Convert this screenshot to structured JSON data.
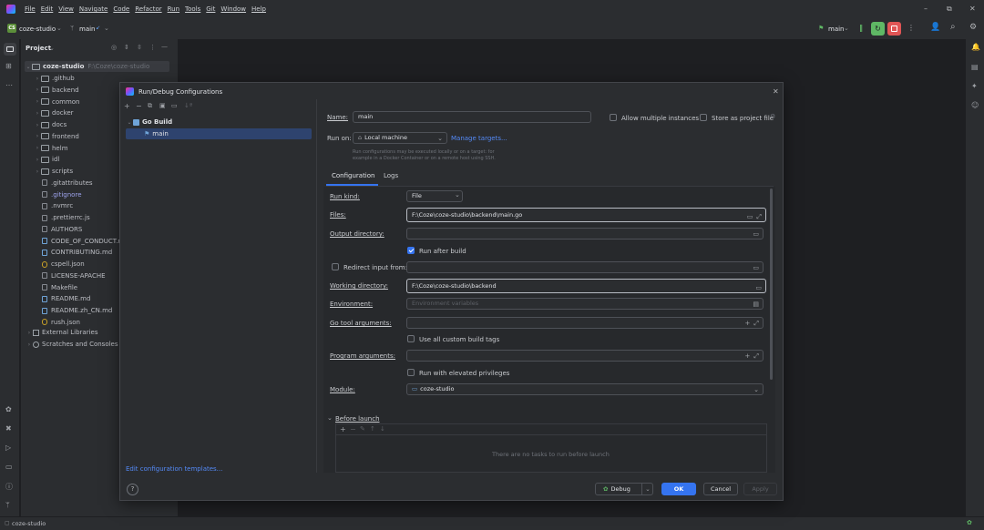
{
  "menu": [
    "File",
    "Edit",
    "View",
    "Navigate",
    "Code",
    "Refactor",
    "Run",
    "Tools",
    "Git",
    "Window",
    "Help"
  ],
  "toolbar": {
    "project_badge": "CS",
    "project_name": "coze-studio",
    "branch": "main",
    "run_config": "main"
  },
  "project_pane": {
    "title": "Project",
    "root_name": "coze-studio",
    "root_path": "F:\\Coze\\coze-studio",
    "items": [
      {
        "label": ".github",
        "type": "folder"
      },
      {
        "label": "backend",
        "type": "folder"
      },
      {
        "label": "common",
        "type": "folder"
      },
      {
        "label": "docker",
        "type": "folder"
      },
      {
        "label": "docs",
        "type": "folder"
      },
      {
        "label": "frontend",
        "type": "folder"
      },
      {
        "label": "helm",
        "type": "folder"
      },
      {
        "label": "idl",
        "type": "folder"
      },
      {
        "label": "scripts",
        "type": "folder"
      },
      {
        "label": ".gitattributes",
        "type": "file"
      },
      {
        "label": ".gitignore",
        "type": "file"
      },
      {
        "label": ".nvmrc",
        "type": "file"
      },
      {
        "label": ".prettierrc.js",
        "type": "file"
      },
      {
        "label": "AUTHORS",
        "type": "file"
      },
      {
        "label": "CODE_OF_CONDUCT.md",
        "type": "md"
      },
      {
        "label": "CONTRIBUTING.md",
        "type": "md"
      },
      {
        "label": "cspell.json",
        "type": "json"
      },
      {
        "label": "LICENSE-APACHE",
        "type": "file"
      },
      {
        "label": "Makefile",
        "type": "file"
      },
      {
        "label": "README.md",
        "type": "md"
      },
      {
        "label": "README.zh_CN.md",
        "type": "md"
      },
      {
        "label": "rush.json",
        "type": "json"
      }
    ],
    "external_libraries": "External Libraries",
    "scratches": "Scratches and Consoles"
  },
  "dialog": {
    "title": "Run/Debug Configurations",
    "tree_group": "Go Build",
    "tree_item": "main",
    "edit_templates": "Edit configuration templates...",
    "name_label": "Name:",
    "name_value": "main",
    "allow_multiple": "Allow multiple instances",
    "store_as_project_file": "Store as project file",
    "run_on_label": "Run on:",
    "run_on_value": "Local machine",
    "manage_targets": "Manage targets...",
    "run_on_hint_1": "Run configurations may be executed locally or on a target: for",
    "run_on_hint_2": "example in a Docker Container or on a remote host using SSH.",
    "tab_configuration": "Configuration",
    "tab_logs": "Logs",
    "run_kind_label": "Run kind:",
    "run_kind_value": "File",
    "files_label": "Files:",
    "files_value": "F:\\Coze\\coze-studio\\backend\\main.go",
    "output_dir_label": "Output directory:",
    "run_after_build": "Run after build",
    "redirect_input": "Redirect input from:",
    "working_dir_label": "Working directory:",
    "working_dir_value": "F:\\Coze\\coze-studio\\backend",
    "environment_label": "Environment:",
    "environment_placeholder": "Environment variables",
    "go_tool_args_label": "Go tool arguments:",
    "use_all_build_tags": "Use all custom build tags",
    "program_args_label": "Program arguments:",
    "run_elevated": "Run with elevated privileges",
    "module_label": "Module:",
    "module_value": "coze-studio",
    "before_launch": "Before launch",
    "no_tasks": "There are no tasks to run before launch",
    "btn_debug": "Debug",
    "btn_ok": "OK",
    "btn_cancel": "Cancel",
    "btn_apply": "Apply",
    "help": "?"
  },
  "statusbar": {
    "project": "coze-studio"
  },
  "colors": {
    "accent": "#3574f0",
    "run_green": "#5fb865",
    "stop_red": "#e05555"
  }
}
